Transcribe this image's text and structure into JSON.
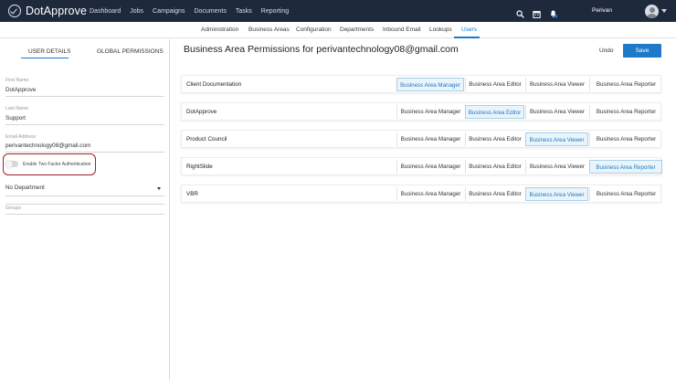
{
  "app": {
    "name": "DotApprove",
    "user": "Perivan"
  },
  "topnav": [
    "Dashboard",
    "Jobs",
    "Campaigns",
    "Documents",
    "Tasks",
    "Reporting"
  ],
  "top_icons": [
    "search-icon",
    "calendar-icon",
    "bell-icon"
  ],
  "subnav": [
    "Administration",
    "Business Areas",
    "Configuration",
    "Departments",
    "Inbound Email",
    "Lookups",
    "Users"
  ],
  "subnav_active": "Users",
  "left": {
    "tabs": [
      "USER DETAILS",
      "GLOBAL PERMISSIONS"
    ],
    "active_tab": "USER DETAILS",
    "first_name_label": "First Name",
    "first_name": "DotApprove",
    "last_name_label": "Last Name",
    "last_name": "Support",
    "email_label": "Email Address",
    "email": "perivantechnology08@gmail.com",
    "two_factor_label": "Enable Two Factor Authentication",
    "two_factor_enabled": false,
    "department": "No Department",
    "groups_label": "Groups"
  },
  "main": {
    "title": "Business Area Permissions for perivantechnology08@gmail.com",
    "undo": "Undo",
    "save": "Save",
    "accent": "#1e79c9",
    "roles": [
      "Business Area Manager",
      "Business Area Editor",
      "Business Area Viewer",
      "Business Area Reporter"
    ],
    "areas": [
      {
        "name": "Client Documentation",
        "selected": "Business Area Manager"
      },
      {
        "name": "DotApprove",
        "selected": "Business Area Editor"
      },
      {
        "name": "Product Council",
        "selected": "Business Area Viewer"
      },
      {
        "name": "RightSlide",
        "selected": "Business Area Reporter"
      },
      {
        "name": "VBR",
        "selected": "Business Area Viewer"
      }
    ]
  }
}
